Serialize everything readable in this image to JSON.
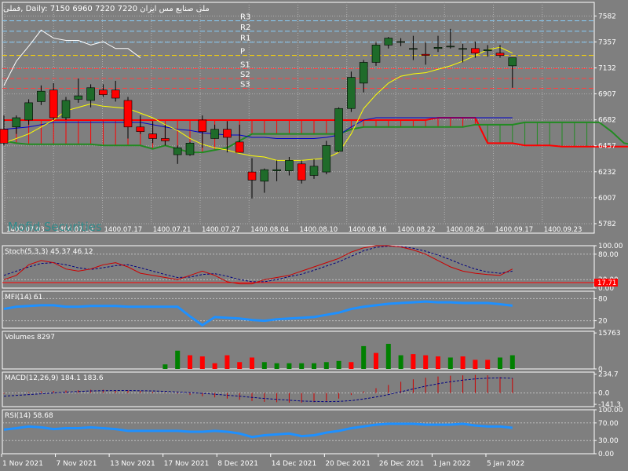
{
  "header": {
    "symbol": "فملی",
    "timeframe": "Daily",
    "ohlc": "7150 6960 7220 7220",
    "name": "ملی صنایع مس ایران"
  },
  "watermark": "Mofid Securities",
  "colors": {
    "background": "#7f7f7f",
    "grid": "#b0b0b0",
    "bull": "#1f6b2a",
    "bear": "#ff0000",
    "conversion": "#ffff00",
    "base": "#0000cc",
    "lagging": "#ffffff",
    "span_a": "#ff0000",
    "span_b": "#228b22",
    "stoch_main": "#cc0000",
    "stoch_signal": "#000080",
    "oscillator_line": "#1e90ff",
    "volume_up": "#008000",
    "volume_down": "#ff0000",
    "macd_hist": "#cc0000",
    "macd_signal": "#000080",
    "pivot_blue": "#87cefa",
    "pivot_yellow": "#ffd700",
    "pivot_red": "#ff4040"
  },
  "chart_data": [
    {
      "type": "candlestick",
      "panel": "main",
      "title": "فملی, Daily:  7150 6960 7220 7220",
      "price_ticks": [
        7582,
        7357,
        7132,
        6907,
        6682,
        6457,
        6232,
        6007,
        5782
      ],
      "ylim": [
        5700,
        7700
      ],
      "x_tick_labels": [
        "1400.07.03",
        "1400.07.10",
        "1400.07.17",
        "1400.07.21",
        "1400.07.27",
        "1400.08.04",
        "1400.08.10",
        "1400.08.16",
        "1400.08.22",
        "1400.08.26",
        "1400.09.17",
        "1400.09.23"
      ],
      "pivots": [
        {
          "label": "R3",
          "value": 7540,
          "color": "blue"
        },
        {
          "label": "R2",
          "value": 7450,
          "color": "blue"
        },
        {
          "label": "R1",
          "value": 7355,
          "color": "blue"
        },
        {
          "label": "P",
          "value": 7240,
          "color": "yellow"
        },
        {
          "label": "S1",
          "value": 7125,
          "color": "red"
        },
        {
          "label": "S2",
          "value": 7040,
          "color": "red"
        },
        {
          "label": "S3",
          "value": 6955,
          "color": "red"
        }
      ],
      "candles": [
        {
          "o": 6600,
          "h": 6720,
          "l": 6460,
          "c": 6480
        },
        {
          "o": 6620,
          "h": 6720,
          "l": 6560,
          "c": 6700
        },
        {
          "o": 6680,
          "h": 6860,
          "l": 6640,
          "c": 6830
        },
        {
          "o": 6840,
          "h": 6980,
          "l": 6810,
          "c": 6930
        },
        {
          "o": 6940,
          "h": 7000,
          "l": 6680,
          "c": 6700
        },
        {
          "o": 6700,
          "h": 6880,
          "l": 6680,
          "c": 6850
        },
        {
          "o": 6860,
          "h": 7040,
          "l": 6830,
          "c": 6890
        },
        {
          "o": 6850,
          "h": 6990,
          "l": 6790,
          "c": 6960
        },
        {
          "o": 6940,
          "h": 6990,
          "l": 6880,
          "c": 6900
        },
        {
          "o": 6940,
          "h": 7020,
          "l": 6840,
          "c": 6870
        },
        {
          "o": 6850,
          "h": 6880,
          "l": 6520,
          "c": 6620
        },
        {
          "o": 6620,
          "h": 6720,
          "l": 6560,
          "c": 6580
        },
        {
          "o": 6560,
          "h": 6670,
          "l": 6480,
          "c": 6520
        },
        {
          "o": 6520,
          "h": 6640,
          "l": 6460,
          "c": 6500
        },
        {
          "o": 6380,
          "h": 6460,
          "l": 6300,
          "c": 6440
        },
        {
          "o": 6380,
          "h": 6490,
          "l": 6370,
          "c": 6480
        },
        {
          "o": 6680,
          "h": 6720,
          "l": 6440,
          "c": 6580
        },
        {
          "o": 6520,
          "h": 6640,
          "l": 6520,
          "c": 6600
        },
        {
          "o": 6600,
          "h": 6670,
          "l": 6400,
          "c": 6530
        },
        {
          "o": 6490,
          "h": 6640,
          "l": 6460,
          "c": 6400
        },
        {
          "o": 6230,
          "h": 6350,
          "l": 6000,
          "c": 6160
        },
        {
          "o": 6150,
          "h": 6260,
          "l": 6050,
          "c": 6250
        },
        {
          "o": 6240,
          "h": 6330,
          "l": 6150,
          "c": 6250
        },
        {
          "o": 6240,
          "h": 6360,
          "l": 6200,
          "c": 6330
        },
        {
          "o": 6300,
          "h": 6330,
          "l": 6130,
          "c": 6160
        },
        {
          "o": 6200,
          "h": 6340,
          "l": 6170,
          "c": 6280
        },
        {
          "o": 6230,
          "h": 6500,
          "l": 6210,
          "c": 6460
        },
        {
          "o": 6410,
          "h": 6790,
          "l": 6400,
          "c": 6780
        },
        {
          "o": 6780,
          "h": 7100,
          "l": 6750,
          "c": 7050
        },
        {
          "o": 7000,
          "h": 7200,
          "l": 6920,
          "c": 7180
        },
        {
          "o": 7180,
          "h": 7350,
          "l": 7150,
          "c": 7330
        },
        {
          "o": 7330,
          "h": 7400,
          "l": 7300,
          "c": 7390
        },
        {
          "o": 7360,
          "h": 7390,
          "l": 7320,
          "c": 7360
        },
        {
          "o": 7300,
          "h": 7410,
          "l": 7200,
          "c": 7300
        },
        {
          "o": 7250,
          "h": 7350,
          "l": 7160,
          "c": 7240
        },
        {
          "o": 7300,
          "h": 7410,
          "l": 7270,
          "c": 7310
        },
        {
          "o": 7320,
          "h": 7470,
          "l": 7300,
          "c": 7320
        },
        {
          "o": 7300,
          "h": 7340,
          "l": 7180,
          "c": 7300
        },
        {
          "o": 7300,
          "h": 7360,
          "l": 7220,
          "c": 7260
        },
        {
          "o": 7280,
          "h": 7330,
          "l": 7230,
          "c": 7290
        },
        {
          "o": 7260,
          "h": 7330,
          "l": 7220,
          "c": 7240
        },
        {
          "o": 7150,
          "h": 7220,
          "l": 6960,
          "c": 7220
        }
      ],
      "ichimoku": {
        "conversion": [
          6480,
          6520,
          6560,
          6620,
          6680,
          6760,
          6790,
          6820,
          6800,
          6790,
          6780,
          6740,
          6700,
          6640,
          6590,
          6520,
          6470,
          6440,
          6420,
          6390,
          6370,
          6360,
          6330,
          6330,
          6330,
          6340,
          6350,
          6400,
          6560,
          6780,
          6900,
          7000,
          7060,
          7080,
          7090,
          7120,
          7150,
          7190,
          7240,
          7290,
          7310,
          7260
        ],
        "base": [
          6600,
          6610,
          6620,
          6640,
          6660,
          6660,
          6660,
          6660,
          6660,
          6660,
          6660,
          6660,
          6640,
          6620,
          6600,
          6590,
          6570,
          6560,
          6550,
          6550,
          6530,
          6530,
          6520,
          6520,
          6520,
          6520,
          6530,
          6550,
          6620,
          6680,
          6700,
          6700,
          6700,
          6700,
          6700,
          6700,
          6700,
          6700,
          6700,
          6700,
          6700,
          6700
        ],
        "lagging": [
          6980,
          7190,
          7320,
          7460,
          7390,
          7370,
          7370,
          7330,
          7360,
          7300,
          7300,
          7220
        ],
        "span_a": [
          6680,
          6680,
          6680,
          6680,
          6680,
          6680,
          6680,
          6680,
          6680,
          6680,
          6680,
          6680,
          6680,
          6680,
          6680,
          6680,
          6680,
          6680,
          6680,
          6680,
          6680,
          6680,
          6680,
          6680,
          6680,
          6680,
          6680,
          6680,
          6680,
          6680,
          6680,
          6680,
          6680,
          6680,
          6680,
          6700,
          6700,
          6700,
          6700,
          6480,
          6480,
          6480,
          6460,
          6460,
          6460,
          6450,
          6450,
          6450,
          6450,
          6450,
          6450,
          6450,
          6450,
          6450
        ],
        "span_b": [
          6500,
          6480,
          6470,
          6470,
          6470,
          6470,
          6470,
          6470,
          6460,
          6460,
          6460,
          6460,
          6430,
          6460,
          6430,
          6400,
          6400,
          6420,
          6440,
          6500,
          6560,
          6560,
          6560,
          6560,
          6560,
          6560,
          6560,
          6560,
          6600,
          6620,
          6620,
          6620,
          6620,
          6620,
          6620,
          6620,
          6620,
          6620,
          6640,
          6640,
          6640,
          6640,
          6660,
          6660,
          6660,
          6660,
          6660,
          6660,
          6660,
          6580,
          6480,
          6460,
          6450,
          6450
        ]
      }
    },
    {
      "type": "line",
      "panel": "stoch",
      "title": "Stoch(5,3,3) 45.37 46.12",
      "y_ticks": [
        "100.00",
        "80.00",
        "20.00",
        "0.00"
      ],
      "ylim": [
        0,
        100
      ],
      "level_label": "17.71",
      "series": [
        {
          "name": "main",
          "values": [
            20,
            30,
            55,
            65,
            60,
            45,
            40,
            45,
            55,
            60,
            50,
            35,
            30,
            25,
            20,
            30,
            40,
            30,
            15,
            10,
            10,
            20,
            25,
            30,
            40,
            50,
            60,
            70,
            85,
            95,
            100,
            100,
            97,
            90,
            80,
            65,
            50,
            40,
            35,
            32,
            30,
            45
          ]
        },
        {
          "name": "signal",
          "values": [
            30,
            40,
            50,
            58,
            60,
            55,
            48,
            44,
            48,
            53,
            55,
            48,
            40,
            32,
            25,
            26,
            32,
            34,
            28,
            20,
            15,
            15,
            20,
            27,
            33,
            42,
            52,
            62,
            75,
            88,
            96,
            99,
            98,
            94,
            87,
            78,
            67,
            55,
            45,
            38,
            35,
            40
          ]
        }
      ]
    },
    {
      "type": "line",
      "panel": "mfi",
      "title": "MFI(14) 61",
      "y_ticks": [
        "80",
        "20"
      ],
      "ylim": [
        0,
        100
      ],
      "series": [
        {
          "name": "MFI",
          "values": [
            52,
            58,
            60,
            62,
            62,
            58,
            58,
            60,
            60,
            60,
            58,
            58,
            58,
            58,
            58,
            32,
            8,
            30,
            28,
            26,
            22,
            20,
            24,
            26,
            28,
            30,
            36,
            42,
            52,
            58,
            62,
            66,
            68,
            70,
            72,
            70,
            70,
            68,
            68,
            68,
            65,
            61
          ]
        }
      ]
    },
    {
      "type": "bar",
      "panel": "volume",
      "title": "Volumes 8297",
      "y_ticks": [
        "15763",
        "0"
      ],
      "ylim": [
        0,
        16500
      ],
      "values": [
        0,
        0,
        0,
        0,
        0,
        0,
        0,
        0,
        0,
        0,
        0,
        0,
        0,
        2000,
        8000,
        6000,
        5500,
        2500,
        6000,
        3000,
        5000,
        3000,
        2500,
        2500,
        2500,
        2500,
        3000,
        3500,
        3000,
        10000,
        7000,
        11000,
        6000,
        6500,
        6000,
        5500,
        5000,
        5500,
        4000,
        4000,
        5000,
        6000
      ],
      "up": [
        1,
        1,
        1,
        1,
        1,
        1,
        1,
        1,
        1,
        1,
        1,
        1,
        1,
        1,
        1,
        0,
        0,
        0,
        0,
        0,
        0,
        1,
        1,
        1,
        1,
        1,
        1,
        1,
        0,
        1,
        0,
        1,
        1,
        0,
        0,
        0,
        1,
        0,
        0,
        0,
        1,
        1
      ]
    },
    {
      "type": "bar",
      "panel": "macd",
      "title": "MACD(12,26,9) 184.1 183.6",
      "y_ticks": [
        "234.7",
        "0.0",
        "-141.3"
      ],
      "ylim": [
        -170,
        260
      ],
      "values": [
        -10,
        5,
        10,
        20,
        25,
        30,
        35,
        40,
        40,
        35,
        30,
        25,
        15,
        5,
        -10,
        -25,
        -40,
        -55,
        -70,
        -85,
        -100,
        -110,
        -115,
        -120,
        -120,
        -115,
        -100,
        -70,
        -25,
        20,
        60,
        100,
        140,
        170,
        190,
        205,
        215,
        220,
        225,
        220,
        200,
        184
      ],
      "signal": [
        -40,
        -30,
        -20,
        -10,
        0,
        10,
        18,
        25,
        28,
        30,
        30,
        28,
        25,
        20,
        12,
        5,
        -5,
        -15,
        -28,
        -40,
        -55,
        -68,
        -80,
        -90,
        -100,
        -105,
        -108,
        -105,
        -95,
        -75,
        -50,
        -20,
        15,
        50,
        85,
        115,
        140,
        160,
        175,
        185,
        188,
        183
      ]
    },
    {
      "type": "line",
      "panel": "rsi",
      "title": "RSI(14) 58.68",
      "y_ticks": [
        "100.00",
        "70.00",
        "30.00",
        "0.00"
      ],
      "ylim": [
        0,
        100
      ],
      "series": [
        {
          "name": "RSI",
          "values": [
            55,
            58,
            62,
            60,
            56,
            58,
            58,
            60,
            58,
            56,
            52,
            52,
            52,
            52,
            52,
            50,
            50,
            52,
            50,
            46,
            38,
            42,
            44,
            46,
            40,
            42,
            48,
            52,
            58,
            62,
            66,
            68,
            68,
            68,
            66,
            66,
            66,
            68,
            64,
            62,
            62,
            59
          ]
        }
      ]
    },
    {
      "type": "axis",
      "panel": "time",
      "x_tick_labels": [
        "1 Nov 2021",
        "7 Nov 2021",
        "13 Nov 2021",
        "17 Nov 2021",
        "8 Dec 2021",
        "14 Dec 2021",
        "20 Dec 2021",
        "26 Dec 2021",
        "1 Jan 2022",
        "5 Jan 2022"
      ]
    }
  ]
}
